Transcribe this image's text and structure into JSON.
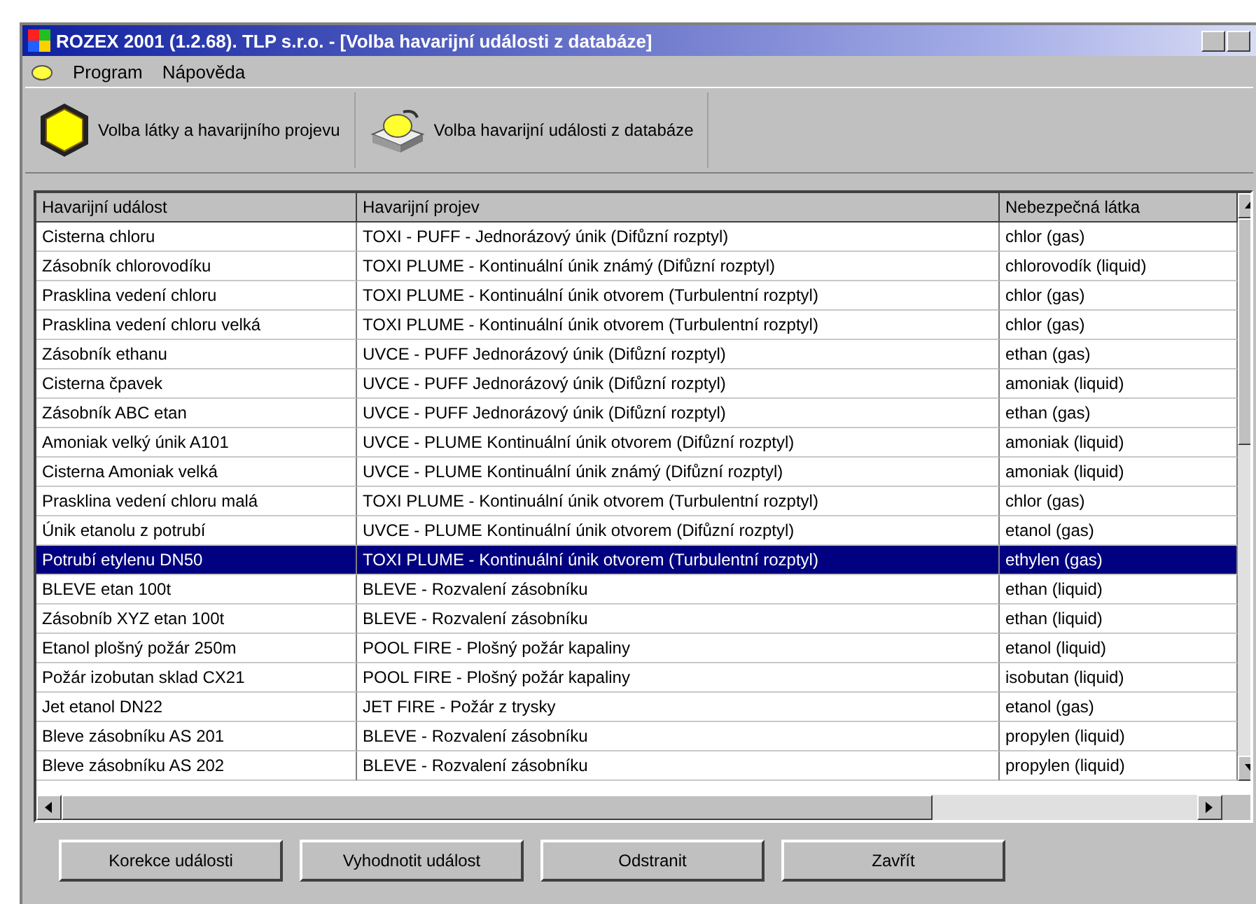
{
  "window": {
    "title": "ROZEX 2001 (1.2.68). TLP s.r.o. - [Volba havarijní události z databáze]"
  },
  "menu": [
    "Program",
    "Nápověda"
  ],
  "toolbar": [
    {
      "label": "Volba látky a havarijního projevu",
      "kind": "hexagon"
    },
    {
      "label": "Volba havarijní události z databáze",
      "kind": "database"
    }
  ],
  "table": {
    "columns": [
      "Havarijní událost",
      "Havarijní projev",
      "Nebezpečná látka"
    ],
    "rows": [
      {
        "cells": [
          "Cisterna chloru",
          "TOXI - PUFF - Jednorázový únik (Difůzní rozptyl)",
          "chlor (gas)"
        ],
        "selected": false
      },
      {
        "cells": [
          "Zásobník chlorovodíku",
          "TOXI PLUME - Kontinuální únik známý (Difůzní rozptyl)",
          "chlorovodík (liquid)"
        ],
        "selected": false
      },
      {
        "cells": [
          "Prasklina vedení chloru",
          "TOXI PLUME - Kontinuální únik otvorem (Turbulentní rozptyl)",
          "chlor (gas)"
        ],
        "selected": false
      },
      {
        "cells": [
          "Prasklina vedení chloru velká",
          "TOXI PLUME - Kontinuální únik otvorem (Turbulentní rozptyl)",
          "chlor (gas)"
        ],
        "selected": false
      },
      {
        "cells": [
          "Zásobník ethanu",
          "UVCE - PUFF Jednorázový únik (Difůzní rozptyl)",
          "ethan (gas)"
        ],
        "selected": false
      },
      {
        "cells": [
          "Cisterna čpavek",
          "UVCE - PUFF Jednorázový únik (Difůzní rozptyl)",
          "amoniak (liquid)"
        ],
        "selected": false
      },
      {
        "cells": [
          "Zásobník ABC etan",
          "UVCE - PUFF Jednorázový únik (Difůzní rozptyl)",
          "ethan (gas)"
        ],
        "selected": false
      },
      {
        "cells": [
          "Amoniak velký únik A101",
          "UVCE - PLUME Kontinuální únik otvorem (Difůzní rozptyl)",
          "amoniak (liquid)"
        ],
        "selected": false
      },
      {
        "cells": [
          "Cisterna Amoniak velká",
          "UVCE - PLUME Kontinuální únik známý (Difůzní rozptyl)",
          "amoniak (liquid)"
        ],
        "selected": false
      },
      {
        "cells": [
          "Prasklina vedení chloru malá",
          "TOXI PLUME - Kontinuální únik otvorem (Turbulentní rozptyl)",
          "chlor (gas)"
        ],
        "selected": false
      },
      {
        "cells": [
          "Únik etanolu z potrubí",
          "UVCE - PLUME Kontinuální únik otvorem (Difůzní rozptyl)",
          "etanol (gas)"
        ],
        "selected": false
      },
      {
        "cells": [
          "Potrubí etylenu DN50",
          "TOXI PLUME - Kontinuální únik otvorem (Turbulentní rozptyl)",
          "ethylen (gas)"
        ],
        "selected": true
      },
      {
        "cells": [
          "BLEVE etan 100t",
          "BLEVE - Rozvalení zásobníku",
          "ethan (liquid)"
        ],
        "selected": false
      },
      {
        "cells": [
          "Zásobníb XYZ etan 100t",
          "BLEVE - Rozvalení zásobníku",
          "ethan (liquid)"
        ],
        "selected": false
      },
      {
        "cells": [
          "Etanol plošný požár 250m",
          "POOL FIRE - Plošný požár kapaliny",
          "etanol (liquid)"
        ],
        "selected": false
      },
      {
        "cells": [
          "Požár izobutan sklad CX21",
          "POOL FIRE - Plošný požár kapaliny",
          "isobutan (liquid)"
        ],
        "selected": false
      },
      {
        "cells": [
          "Jet etanol DN22",
          "JET FIRE - Požár z trysky",
          "etanol (gas)"
        ],
        "selected": false
      },
      {
        "cells": [
          "Bleve zásobníku AS 201",
          "BLEVE - Rozvalení zásobníku",
          "propylen (liquid)"
        ],
        "selected": false
      },
      {
        "cells": [
          "Bleve zásobníku AS 202",
          "BLEVE - Rozvalení zásobníku",
          "propylen (liquid)"
        ],
        "selected": false
      }
    ]
  },
  "buttons": [
    "Korekce události",
    "Vyhodnotit událost",
    "Odstranit",
    "Zavřít"
  ]
}
